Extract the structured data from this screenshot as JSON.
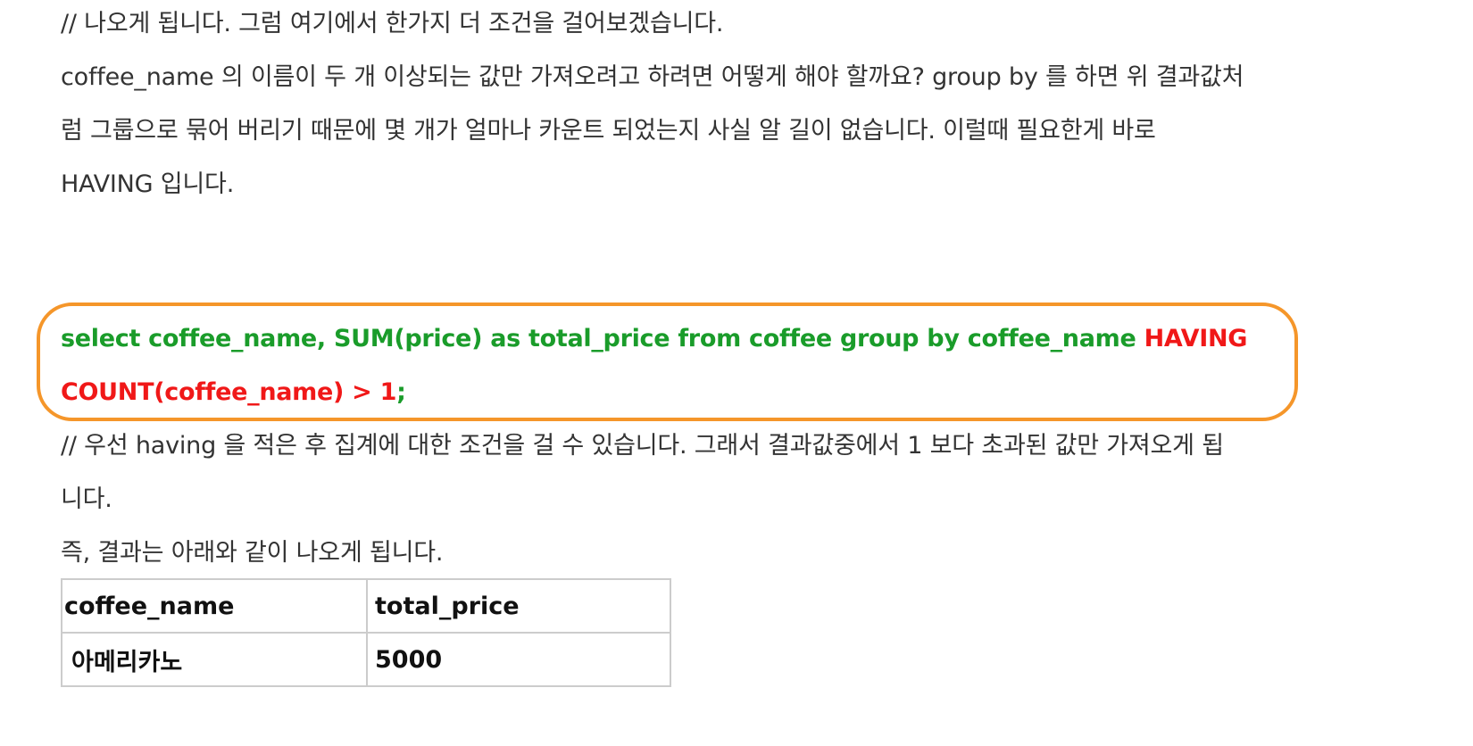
{
  "paragraphs": {
    "intro": "// 나오게 됩니다. 그럼 여기에서 한가지 더 조건을 걸어보겠습니다.",
    "question_line1": "coffee_name 의 이름이 두 개 이상되는 값만 가져오려고 하려면 어떻게 해야 할까요? group by 를 하면 위 결과값처",
    "question_line2": "럼 그룹으로 묶어 버리기 때문에 몇 개가 얼마나 카운트 되었는지 사실 알 길이 없습니다. 이럴때 필요한게 바로",
    "question_line3": "HAVING 입니다.",
    "explain_line1": "// 우선 having 을 적은 후 집계에 대한 조건을 걸 수 있습니다. 그래서 결과값중에서 1 보다 초과된 값만 가져오게 됩",
    "explain_line2": "니다.",
    "result_intro": "즉, 결과는 아래와 같이 나오게 됩니다."
  },
  "code": {
    "line1_green": "select coffee_name, SUM(price) as total_price from coffee group by coffee_name ",
    "line1_red": "HAVING",
    "line2_red": "COUNT(coffee_name) > 1",
    "line2_green": ";"
  },
  "colors": {
    "code_green": "#1a9c2a",
    "code_red": "#f01818",
    "highlight_border": "#f5962a"
  },
  "table": {
    "headers": [
      "coffee_name",
      "total_price"
    ],
    "rows": [
      [
        "아메리카노",
        "5000"
      ]
    ]
  }
}
